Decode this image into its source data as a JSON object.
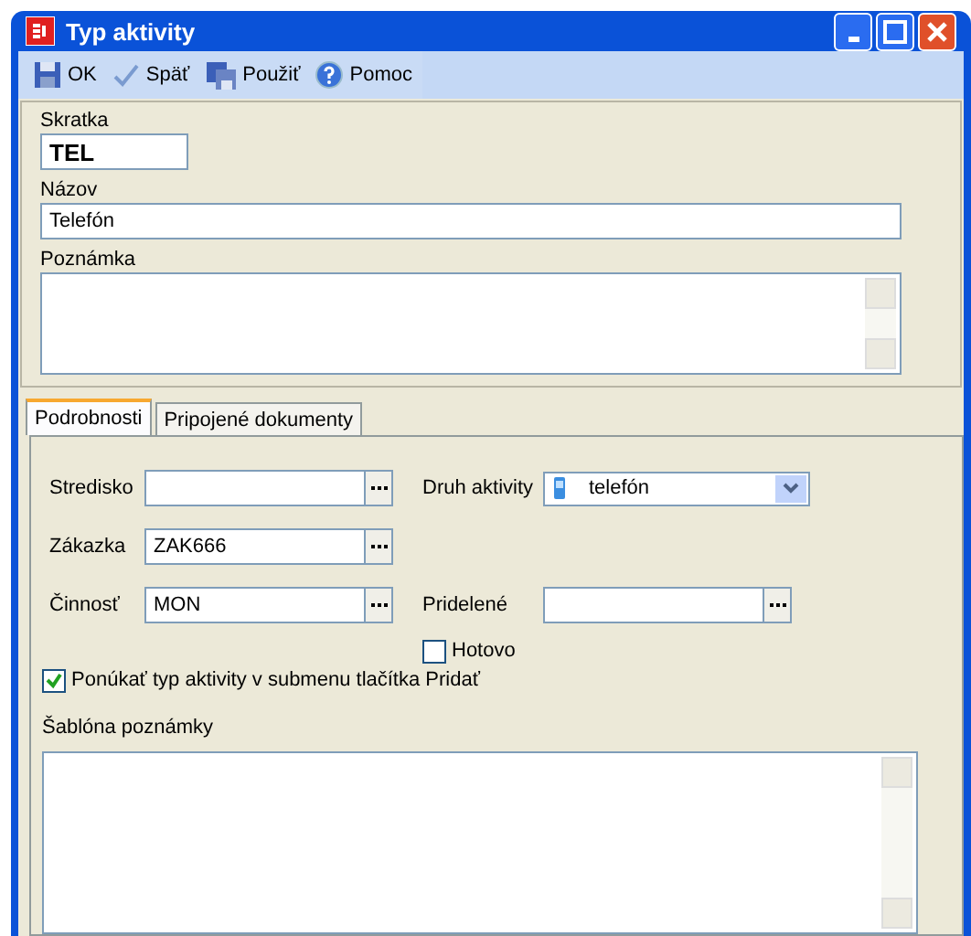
{
  "window": {
    "title": "Typ aktivity"
  },
  "toolbar": [
    {
      "kind": "save",
      "label": "OK"
    },
    {
      "kind": "check",
      "label": "Späť"
    },
    {
      "kind": "apply",
      "label": "Použiť"
    },
    {
      "kind": "help",
      "label": "Pomoc"
    }
  ],
  "header": {
    "code": {
      "label": "Skratka",
      "value": "TEL"
    },
    "name": {
      "label": "Názov",
      "value": "Telefón"
    },
    "note": {
      "label": "Poznámka"
    }
  },
  "tabs": [
    {
      "label": "Podrobnosti",
      "selected": true
    },
    {
      "label": "Pripojené dokumenty",
      "selected": false
    }
  ],
  "details": {
    "center": {
      "label": "Stredisko"
    },
    "order": {
      "label": "Zákazka",
      "value": "ZAK666"
    },
    "activity": {
      "label": "Činnosť",
      "value": "MON"
    },
    "type": {
      "label": "Druh aktivity",
      "value": "telefón"
    },
    "assigned": {
      "label": "Pridelené"
    },
    "done": {
      "label": "Hotovo",
      "checked": false
    },
    "offer": {
      "label": "Ponúkať typ aktivity v submenu tlačítka Pridať",
      "checked": true
    },
    "template": {
      "label": "Šablóna poznámky"
    }
  }
}
